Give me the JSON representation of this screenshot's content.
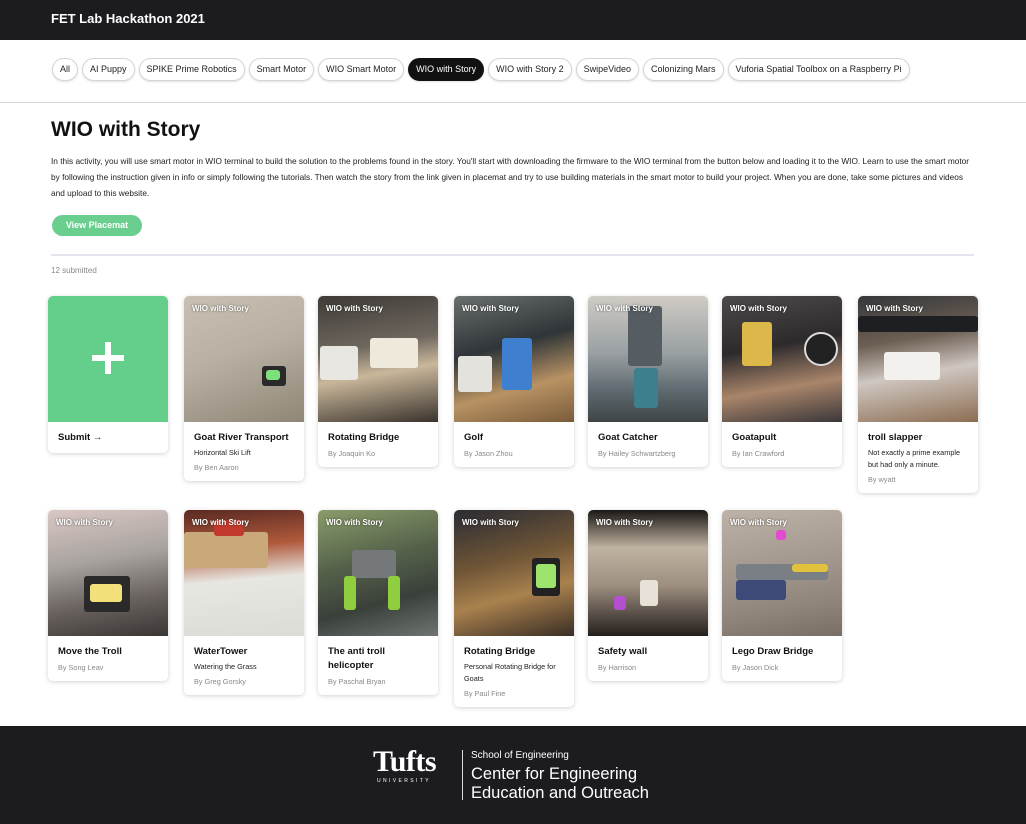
{
  "header": {
    "title": "FET Lab Hackathon 2021"
  },
  "tabs": [
    {
      "label": "All"
    },
    {
      "label": "AI Puppy"
    },
    {
      "label": "SPIKE Prime Robotics"
    },
    {
      "label": "Smart Motor"
    },
    {
      "label": "WIO Smart Motor"
    },
    {
      "label": "WIO with Story",
      "active": true
    },
    {
      "label": "WIO with Story 2"
    },
    {
      "label": "SwipeVideo"
    },
    {
      "label": "Colonizing Mars"
    },
    {
      "label": "Vuforia Spatial Toolbox on a Raspberry Pi"
    }
  ],
  "main": {
    "title": "WIO with Story",
    "description": "In this activity, you will use smart motor in WIO terminal to build the solution to the problems found in the story. You'll start with downloading the firmware to the WIO terminal from the button below and loading it to the WIO. Learn to use the smart motor by following the instruction given in info or simply following the tutorials. Then watch the story from the link given in placemat and try to use building materials in the smart motor to build your project. When you are done, take some pictures and videos and upload to this website.",
    "placemat_button": "View Placemat",
    "submitted_count": "12 submitted"
  },
  "submit_card": {
    "label": "Submit →"
  },
  "badge": "WIO with Story",
  "cards": [
    {
      "title": "Goat River Transport",
      "subtitle": "Horizontal Ski Lift",
      "author": "By Ben Aaron"
    },
    {
      "title": "Rotating Bridge",
      "subtitle": "",
      "author": "By Joaquin Ko"
    },
    {
      "title": "Golf",
      "subtitle": "",
      "author": "By Jason Zhou"
    },
    {
      "title": "Goat Catcher",
      "subtitle": "",
      "author": "By Hailey Schwartzberg"
    },
    {
      "title": "Goatapult",
      "subtitle": "",
      "author": "By Ian Crawford"
    },
    {
      "title": "troll slapper",
      "subtitle": "Not exactly a prime example but had only a minute.",
      "author": "By wyatt"
    },
    {
      "title": "Move the Troll",
      "subtitle": "",
      "author": "By Song Leav"
    },
    {
      "title": "WaterTower",
      "subtitle": "Watering the Grass",
      "author": "By Greg Gorsky"
    },
    {
      "title": "The anti troll helicopter",
      "subtitle": "",
      "author": "By Paschal Bryan"
    },
    {
      "title": "Rotating Bridge",
      "subtitle": "Personal Rotating Bridge for Goats",
      "author": "By Paul Fine"
    },
    {
      "title": "Safety wall",
      "subtitle": "",
      "author": "By Harrison"
    },
    {
      "title": "Lego Draw Bridge",
      "subtitle": "",
      "author": "By Jason Dick"
    }
  ],
  "footer": {
    "logo": "Tufts",
    "university": "UNIVERSITY",
    "school": "School of Engineering",
    "center_line1": "Center for Engineering",
    "center_line2": "Education and Outreach"
  }
}
